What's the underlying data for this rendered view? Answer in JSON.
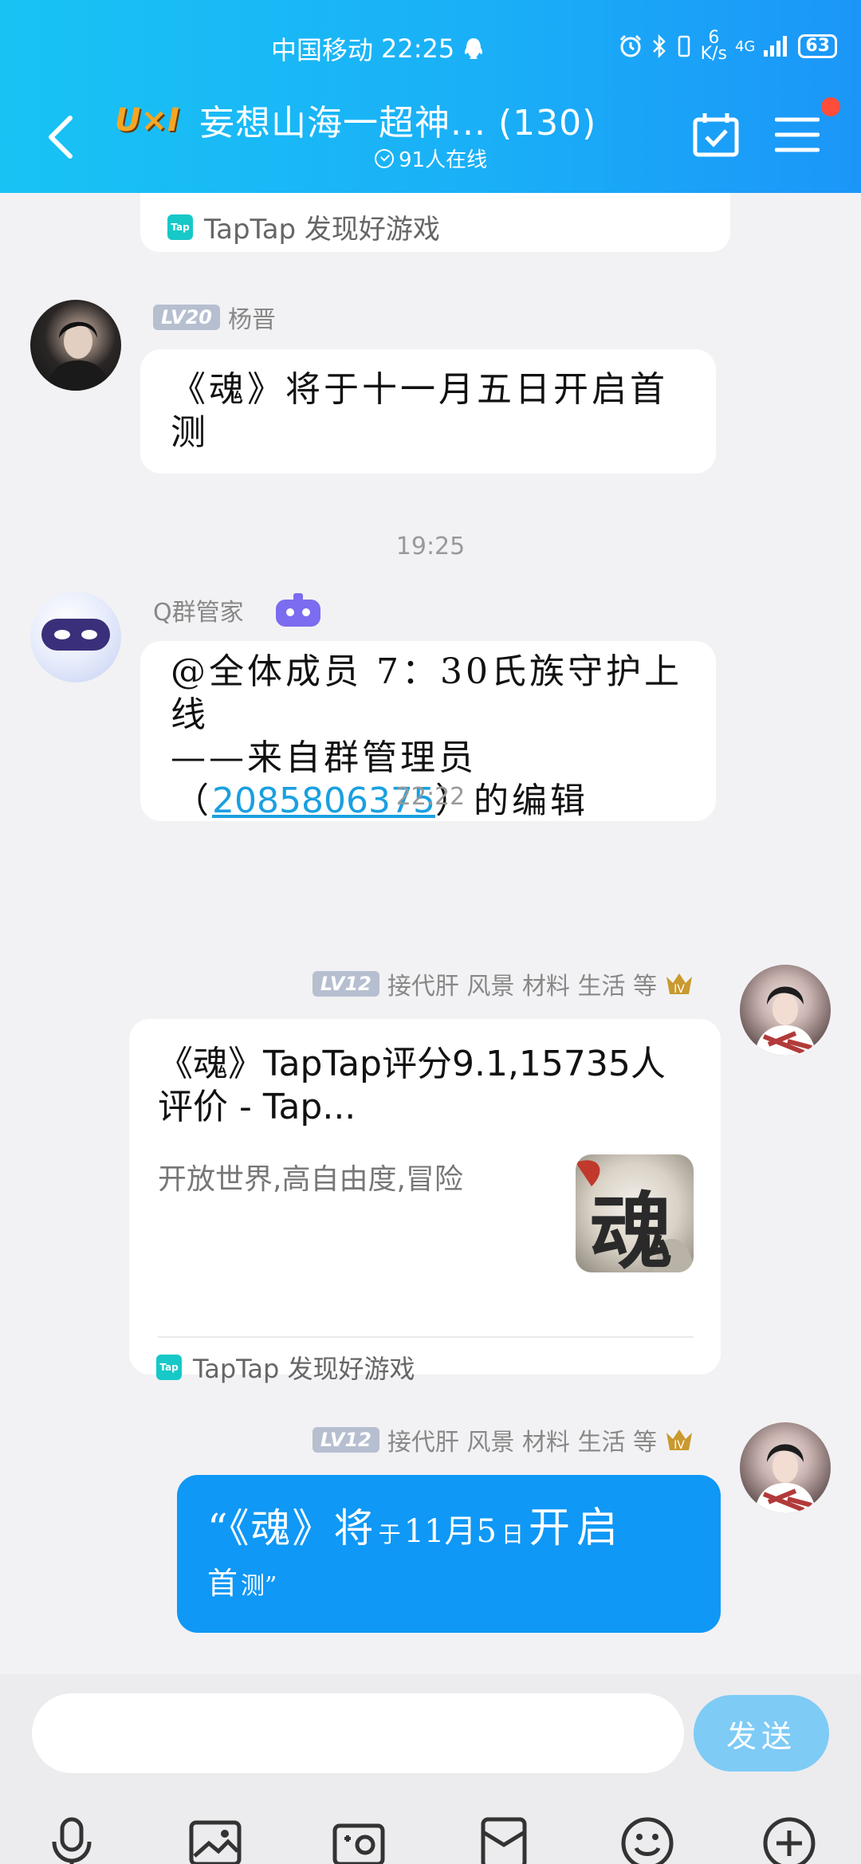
{
  "status_bar": {
    "carrier": "中国移动",
    "time": "22:25",
    "net_speed_value": "6",
    "net_speed_unit": "K/s",
    "network": "4G",
    "battery": "63"
  },
  "header": {
    "logo_text": "U×I",
    "title": "妄想山海一超神... (130)",
    "online_count": "91人在线"
  },
  "messages": {
    "card_top_source": "TapTap 发现好游戏",
    "msg1": {
      "level": "LV20",
      "sender": "杨晋",
      "text": "《魂》将于十一月五日开启首测"
    },
    "time1": "19:25",
    "msg2": {
      "sender": "Q群管家",
      "line1": "@全体成员 7：30氏族守护上线",
      "line2": "——来自群管理员",
      "line3_prefix": "（",
      "link": "2085806375",
      "line3_suffix": "）的编辑"
    },
    "time2": "22:22",
    "msg3": {
      "level": "LV12",
      "sender": "接代肝 风景 材料 生活 等",
      "card_title": "《魂》TapTap评分9.1,15735人评价 - Tap...",
      "card_desc": "开放世界,高自由度,冒险",
      "thumb_char": "魂",
      "card_source": "TapTap 发现好游戏"
    },
    "msg4": {
      "level": "LV12",
      "sender": "接代肝 风景 材料 生活 等",
      "text_a": "“《魂》将",
      "text_b": "于",
      "text_c": "11月5",
      "text_d": "日",
      "text_e": "开启",
      "text_f": "首",
      "text_g": "测”"
    }
  },
  "input": {
    "placeholder": "",
    "send_label": "发送"
  },
  "colors": {
    "header_gradient_start": "#18c3f4",
    "header_gradient_end": "#1b96f8",
    "my_bubble": "#0f98f6",
    "send_button": "#7ecbf6",
    "badge_dot": "#ff4d3a"
  }
}
